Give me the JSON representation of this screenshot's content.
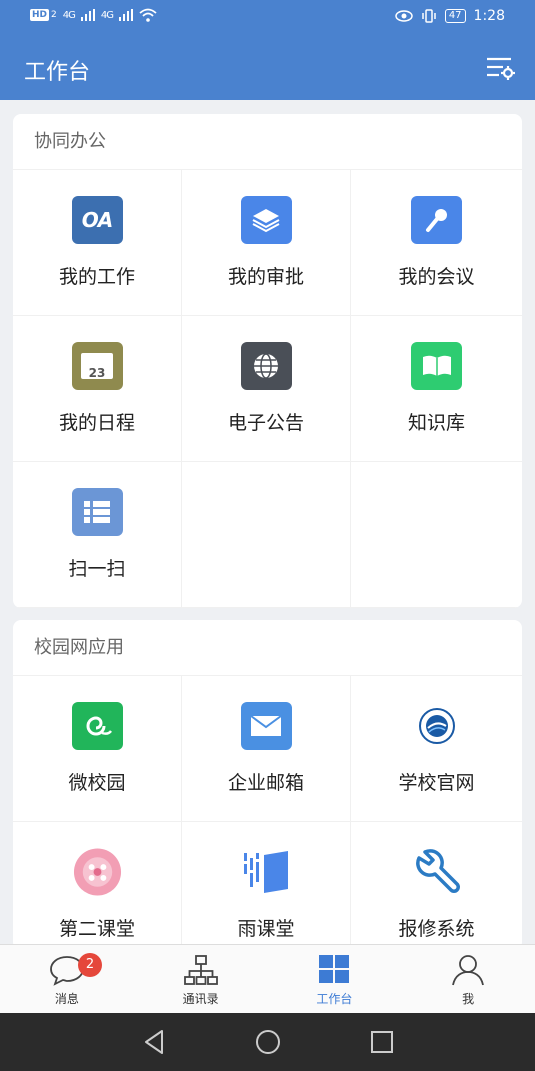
{
  "status_bar": {
    "hd": "HD",
    "sim": "2",
    "net1": "4G",
    "net2": "4G",
    "battery": "47",
    "time": "1:28"
  },
  "header": {
    "title": "工作台"
  },
  "sections": [
    {
      "title": "协同办公",
      "items": [
        {
          "label": "我的工作",
          "icon": "oa-icon",
          "color": "#3c6fb0"
        },
        {
          "label": "我的审批",
          "icon": "layers-icon",
          "color": "#4a86e8"
        },
        {
          "label": "我的会议",
          "icon": "microphone-icon",
          "color": "#4a86e8"
        },
        {
          "label": "我的日程",
          "icon": "calendar-icon",
          "color": "#8f8a4e",
          "day": "23"
        },
        {
          "label": "电子公告",
          "icon": "globe-icon",
          "color": "#4a4f57"
        },
        {
          "label": "知识库",
          "icon": "book-icon",
          "color": "#2ecc71"
        },
        {
          "label": "扫一扫",
          "icon": "list-icon",
          "color": "#6b96d6"
        }
      ]
    },
    {
      "title": "校园网应用",
      "items": [
        {
          "label": "微校园",
          "icon": "weixiao-icon",
          "color": "#21b55a"
        },
        {
          "label": "企业邮箱",
          "icon": "mail-icon",
          "color": "#4a90e2"
        },
        {
          "label": "学校官网",
          "icon": "school-emblem-icon",
          "color": "#1a5aa5"
        },
        {
          "label": "第二课堂",
          "icon": "flower-icon",
          "color": "#f29eb4"
        },
        {
          "label": "雨课堂",
          "icon": "yuketang-icon",
          "color": "#4a86e8"
        },
        {
          "label": "报修系统",
          "icon": "wrench-icon",
          "color": "#2b7bc4"
        }
      ]
    }
  ],
  "bottom_nav": [
    {
      "label": "消息",
      "icon": "chat-bubble-icon",
      "badge": "2"
    },
    {
      "label": "通讯录",
      "icon": "org-chart-icon"
    },
    {
      "label": "工作台",
      "icon": "grid-icon",
      "active": true
    },
    {
      "label": "我",
      "icon": "person-icon"
    }
  ]
}
